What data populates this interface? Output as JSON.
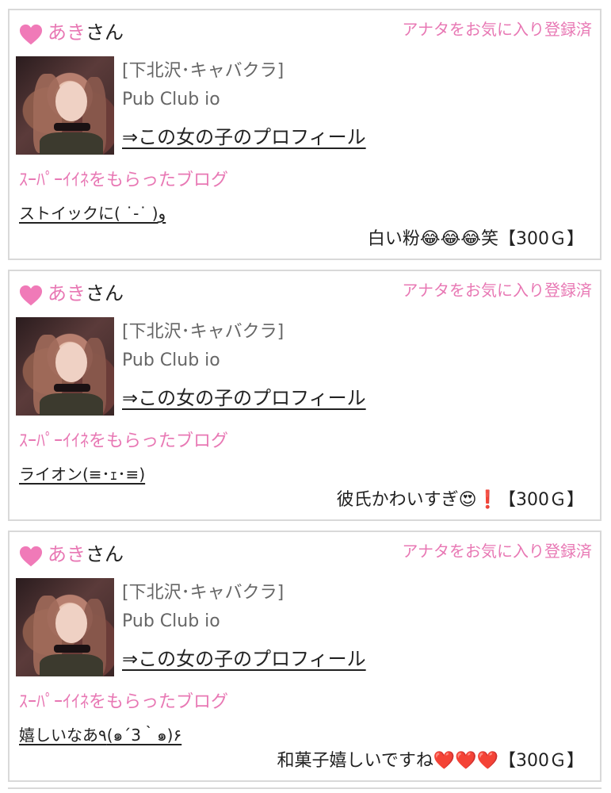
{
  "cards": [
    {
      "name": "あき",
      "name_suffix": "さん",
      "favorite_label": "アナタをお気に入り登録済",
      "location": "[下北沢･キャバクラ]",
      "club": "Pub Club io",
      "profile_link": "⇒この女の子のプロフィール",
      "blog_label": "ｽｰﾊﾟｰｲｲﾈをもらったブログ",
      "blog_title": "ストイックに( ˙-˙ )و",
      "comment": "白い粉😂😂😂笑【300Ｇ】"
    },
    {
      "name": "あき",
      "name_suffix": "さん",
      "favorite_label": "アナタをお気に入り登録済",
      "location": "[下北沢･キャバクラ]",
      "club": "Pub Club io",
      "profile_link": "⇒この女の子のプロフィール",
      "blog_label": "ｽｰﾊﾟｰｲｲﾈをもらったブログ",
      "blog_title": "ライオン(≡･ｪ･≡)",
      "comment": "彼氏かわいすぎ😍❗️【300Ｇ】"
    },
    {
      "name": "あき",
      "name_suffix": "さん",
      "favorite_label": "アナタをお気に入り登録済",
      "location": "[下北沢･キャバクラ]",
      "club": "Pub Club io",
      "profile_link": "⇒この女の子のプロフィール",
      "blog_label": "ｽｰﾊﾟｰｲｲﾈをもらったブログ",
      "blog_title": "嬉しいなあ٩(๑´3｀๑)۶",
      "comment": "和菓子嬉しいですね❤️❤️❤️【300Ｇ】"
    }
  ],
  "colors": {
    "accent_pink": "#e878b4",
    "border": "#d9d9d9"
  },
  "icons": {
    "heart": "heart-icon"
  }
}
